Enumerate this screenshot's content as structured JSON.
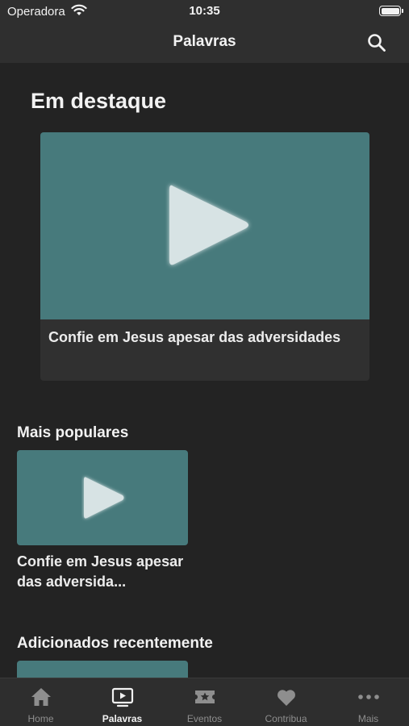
{
  "status_bar": {
    "carrier": "Operadora",
    "time": "10:35"
  },
  "nav": {
    "title": "Palavras",
    "search_icon": "search-icon"
  },
  "featured": {
    "heading": "Em destaque",
    "caption": "Confie em Jesus apesar das adversidades"
  },
  "popular": {
    "heading": "Mais populares",
    "caption": "Confie em Jesus apesar das adversida..."
  },
  "recent": {
    "heading": "Adicionados recentemente"
  },
  "tabs": [
    {
      "label": "Home",
      "icon": "home-icon",
      "active": false
    },
    {
      "label": "Palavras",
      "icon": "video-play-icon",
      "active": true
    },
    {
      "label": "Eventos",
      "icon": "ticket-star-icon",
      "active": false
    },
    {
      "label": "Contribua",
      "icon": "heart-icon",
      "active": false
    },
    {
      "label": "Mais",
      "icon": "more-dots-icon",
      "active": false
    }
  ],
  "colors": {
    "background": "#232323",
    "bar": "#2f2f2f",
    "thumbnail": "#477a7c",
    "active_tab": "#f2f2f2",
    "inactive_tab": "#8e8e8e"
  }
}
